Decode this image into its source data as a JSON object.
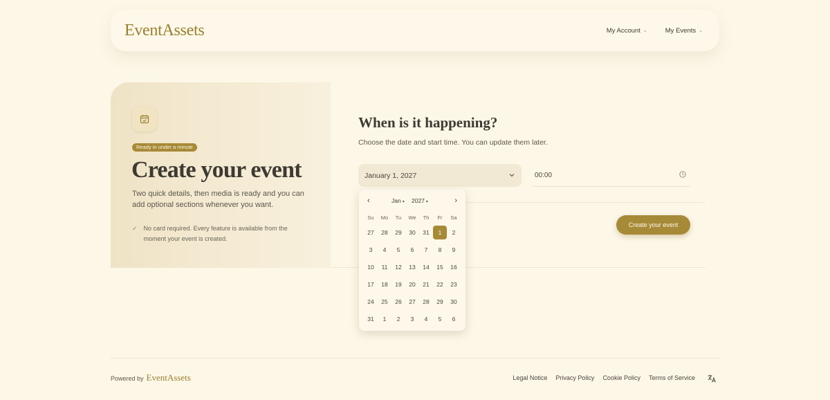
{
  "header": {
    "logo": "EventAssets",
    "nav": [
      {
        "label": "My Account"
      },
      {
        "label": "My Events"
      }
    ]
  },
  "intro": {
    "badge": "Ready in under a minute",
    "title": "Create your event",
    "description": "Two quick details, then media is ready and you can add optional sections whenever you want.",
    "note": "No card required. Every feature is available from the moment your event is created."
  },
  "form": {
    "title": "When is it happening?",
    "subtitle": "Choose the date and start time. You can update them later.",
    "date_value": "January 1, 2027",
    "time_value": "00:00",
    "submit_label": "Create your event"
  },
  "datepicker": {
    "month": "Jan",
    "year": "2027",
    "weekdays": [
      "Su",
      "Mo",
      "Tu",
      "We",
      "Th",
      "Fr",
      "Sa"
    ],
    "weeks": [
      [
        "27",
        "28",
        "29",
        "30",
        "31",
        "1",
        "2"
      ],
      [
        "3",
        "4",
        "5",
        "6",
        "7",
        "8",
        "9"
      ],
      [
        "10",
        "11",
        "12",
        "13",
        "14",
        "15",
        "16"
      ],
      [
        "17",
        "18",
        "19",
        "20",
        "21",
        "22",
        "23"
      ],
      [
        "24",
        "25",
        "26",
        "27",
        "28",
        "29",
        "30"
      ],
      [
        "31",
        "1",
        "2",
        "3",
        "4",
        "5",
        "6"
      ]
    ],
    "selected": "1"
  },
  "footer": {
    "powered_by": "Powered by",
    "logo": "EventAssets",
    "links": [
      {
        "label": "Legal Notice"
      },
      {
        "label": "Privacy Policy"
      },
      {
        "label": "Cookie Policy"
      },
      {
        "label": "Terms of Service"
      }
    ]
  },
  "colors": {
    "accent": "#a68a38",
    "background": "#fdf7e8",
    "logo": "#9a7f2e"
  },
  "icons": {
    "calendar": "calendar-check-icon",
    "clock": "clock-icon",
    "language": "translate-icon"
  }
}
